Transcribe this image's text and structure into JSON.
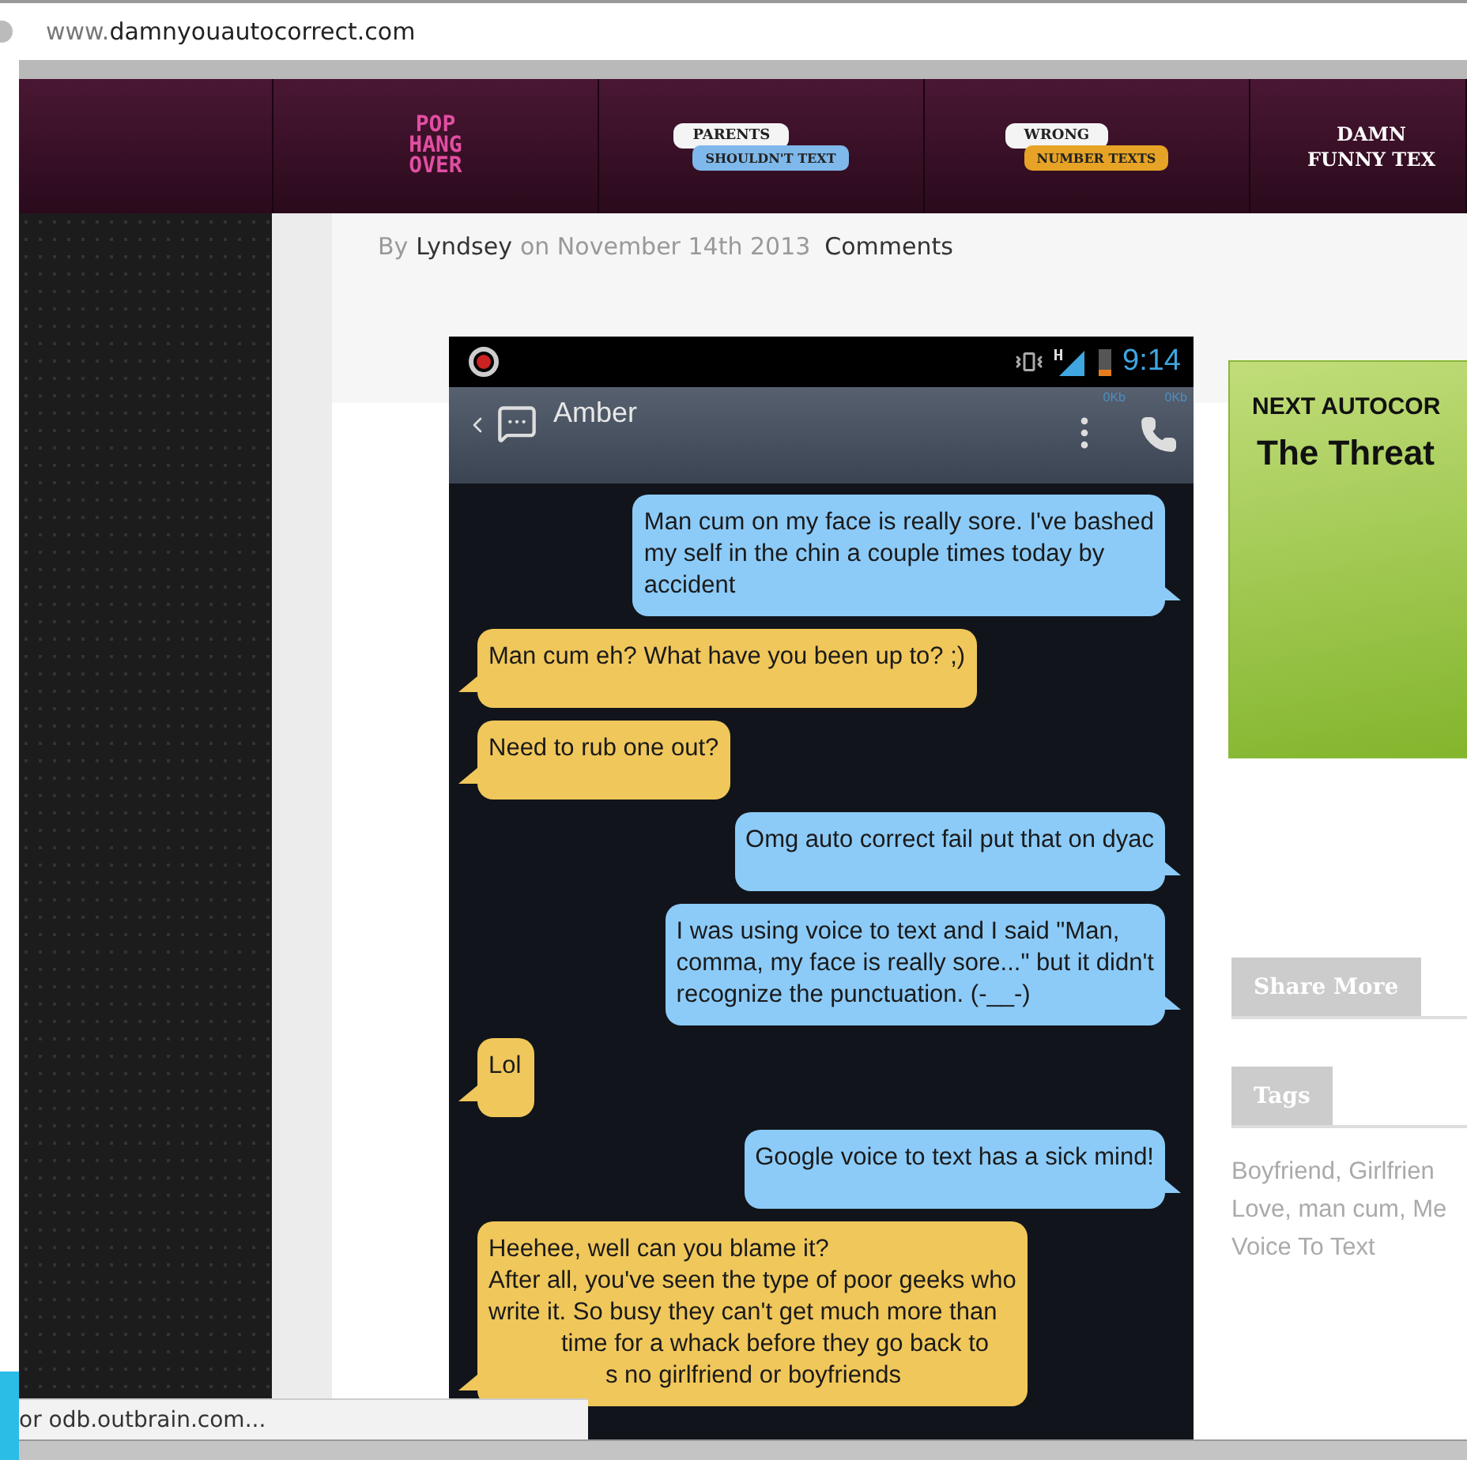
{
  "address_bar": {
    "url_prefix": "www.",
    "url_domain": "damnyouautocorrect.com"
  },
  "nav": [
    {
      "kind": "stack",
      "lines": [
        "POP",
        "HANG",
        "OVER"
      ]
    },
    {
      "kind": "bubbles",
      "top": "PARENTS",
      "bottom": "SHOULDN'T TEXT",
      "color": "#7fb8ea"
    },
    {
      "kind": "bubbles",
      "top": "WRONG",
      "bottom": "NUMBER TEXTS",
      "color": "#e6a325"
    },
    {
      "kind": "title",
      "lines": [
        "DAMN",
        "FUNNY TEX"
      ]
    }
  ],
  "byline": {
    "by": "By",
    "author": "Lyndsey",
    "date": "on November 14th 2013",
    "comments": "Comments"
  },
  "phone": {
    "time": "9:14",
    "contact": "Amber",
    "data_up": "0Kb",
    "data_down": "0Kb",
    "messages": [
      {
        "kind": "sent",
        "lines": [
          "Man cum on my face is really sore. I've bashed",
          "my self in the chin a couple times today by",
          "accident"
        ]
      },
      {
        "kind": "received",
        "lines": [
          "Man cum eh? What have you been up to? ;)"
        ]
      },
      {
        "kind": "received",
        "lines": [
          "Need to rub one out?"
        ]
      },
      {
        "kind": "sent",
        "lines": [
          "Omg auto correct fail put that on dyac"
        ]
      },
      {
        "kind": "sent",
        "lines": [
          "I was using voice to text and I said \"Man,",
          "comma, my face is really sore...\" but it didn't",
          "recognize the punctuation. (-__-)"
        ]
      },
      {
        "kind": "received",
        "lines": [
          "Lol"
        ]
      },
      {
        "kind": "sent",
        "lines": [
          "Google voice to text has a sick mind!"
        ]
      },
      {
        "kind": "received",
        "lines": [
          "Heehee, well can you blame it?",
          "After all, you've seen the type of poor geeks who",
          "write it. So busy they can't get much more than",
          "time for a whack before they go back to",
          "s no girlfriend or boyfriends"
        ]
      }
    ]
  },
  "next_card": {
    "label": "NEXT AUTOCOR",
    "title": "The Threat"
  },
  "share_tab": "Share More",
  "tags_tab": "Tags",
  "tags": [
    "Boyfriend, Girlfrien",
    "Love, man cum, Me",
    "Voice To Text"
  ],
  "status_bar": "or odb.outbrain.com..."
}
